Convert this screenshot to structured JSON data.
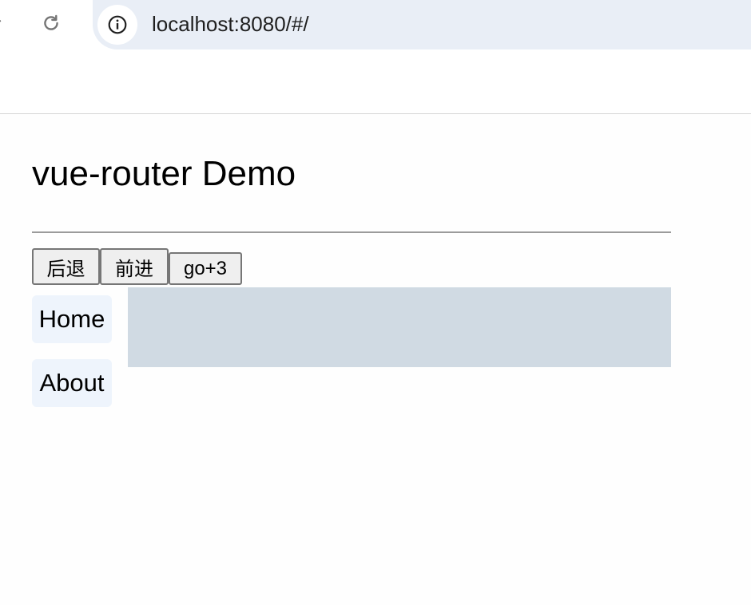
{
  "browser": {
    "url": "localhost:8080/#/",
    "icons": {
      "reload": "reload-icon",
      "site_info": "info-icon"
    }
  },
  "page": {
    "title": "vue-router Demo",
    "buttons": {
      "back": "后退",
      "forward": "前进",
      "go3": "go+3"
    },
    "links": [
      {
        "label": "Home"
      },
      {
        "label": "About"
      }
    ]
  },
  "colors": {
    "omnibox_bg": "#e9eef6",
    "link_bg": "#eef4fc",
    "router_view_bg": "#d0dae3",
    "button_bg": "#efefef"
  }
}
